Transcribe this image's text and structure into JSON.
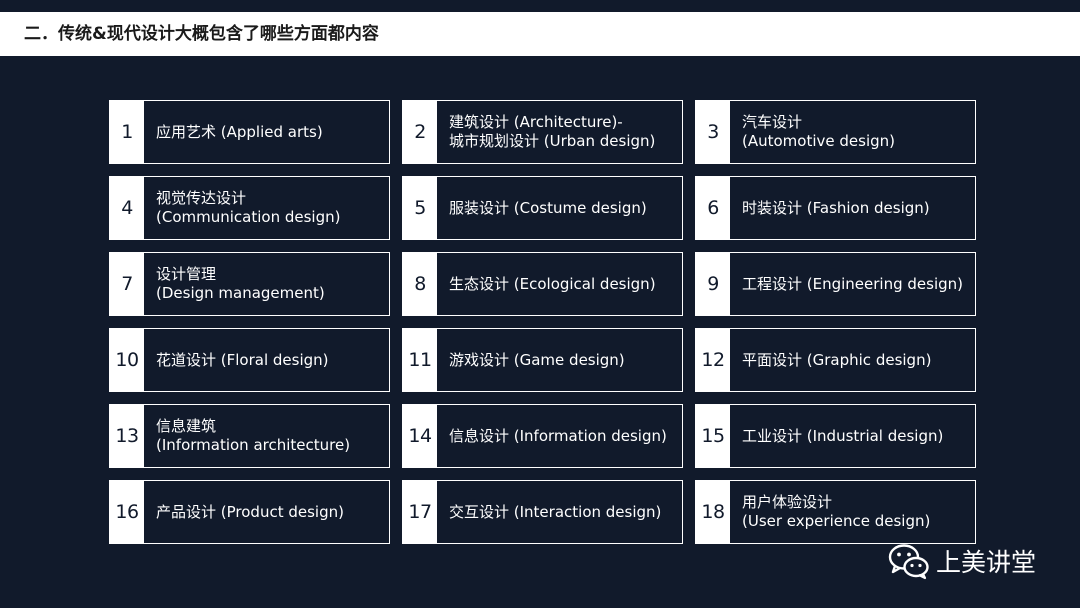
{
  "header": {
    "title": "二．传统&现代设计大概包含了哪些方面都内容"
  },
  "items": [
    {
      "num": "1",
      "line1": "应用艺术 (Applied arts)",
      "line2": ""
    },
    {
      "num": "2",
      "line1": "建筑设计 (Architecture)-",
      "line2": "城市规划设计 (Urban design)"
    },
    {
      "num": "3",
      "line1": "汽车设计",
      "line2": "(Automotive design)"
    },
    {
      "num": "4",
      "line1": "视觉传达设计",
      "line2": "(Communication design)"
    },
    {
      "num": "5",
      "line1": "服装设计 (Costume design)",
      "line2": ""
    },
    {
      "num": "6",
      "line1": "时装设计 (Fashion design)",
      "line2": ""
    },
    {
      "num": "7",
      "line1": "设计管理",
      "line2": "(Design management)"
    },
    {
      "num": "8",
      "line1": "生态设计 (Ecological design)",
      "line2": ""
    },
    {
      "num": "9",
      "line1": "工程设计 (Engineering design)",
      "line2": ""
    },
    {
      "num": "10",
      "line1": "花道设计 (Floral design)",
      "line2": ""
    },
    {
      "num": "11",
      "line1": "游戏设计 (Game design)",
      "line2": ""
    },
    {
      "num": "12",
      "line1": "平面设计 (Graphic design)",
      "line2": ""
    },
    {
      "num": "13",
      "line1": "信息建筑",
      "line2": "(Information architecture)"
    },
    {
      "num": "14",
      "line1": "信息设计 (Information design)",
      "line2": ""
    },
    {
      "num": "15",
      "line1": "工业设计 (Industrial design)",
      "line2": ""
    },
    {
      "num": "16",
      "line1": "产品设计 (Product design)",
      "line2": ""
    },
    {
      "num": "17",
      "line1": "交互设计 (Interaction design)",
      "line2": ""
    },
    {
      "num": "18",
      "line1": "用户体验设计",
      "line2": "(User experience design)"
    }
  ],
  "brand": {
    "icon": "wechat-icon",
    "name": "上美讲堂"
  }
}
